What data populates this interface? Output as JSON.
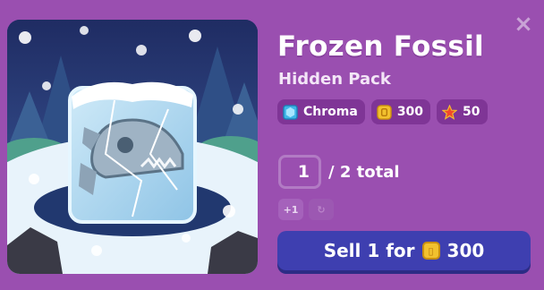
{
  "dialog": {
    "close_glyph": "×",
    "title": "Frozen Fossil",
    "subtitle": "Hidden Pack",
    "badges": [
      {
        "label": "Chroma",
        "icon": "chroma-gem-icon",
        "color": "#3fb6e8"
      },
      {
        "label": "300",
        "icon": "coin-icon",
        "color": "#f2c12e"
      },
      {
        "label": "50",
        "icon": "star-icon",
        "color": "#f04a2a"
      }
    ],
    "quantity": {
      "value": "1",
      "total_text": "/ 2 total"
    },
    "increment_label": "+1",
    "reset_glyph": "↻",
    "sell": {
      "prefix": "Sell 1 for",
      "amount": "300"
    }
  },
  "colors": {
    "background": "#9a4fb0",
    "sell_button": "#3e3fb0"
  }
}
